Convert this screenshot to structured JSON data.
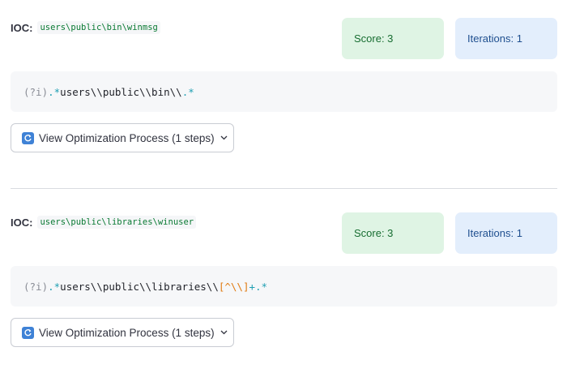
{
  "entries": [
    {
      "ioc_label": "IOC:",
      "ioc_value": "users\\public\\bin\\winmsg",
      "score_label": "Score: 3",
      "iterations_label": "Iterations: 1",
      "regex_tokens": [
        {
          "t": "(?i)",
          "k": "paren"
        },
        {
          "t": ".*",
          "k": "op"
        },
        {
          "t": "users\\\\public\\\\bin\\\\",
          "k": "text"
        },
        {
          "t": ".*",
          "k": "op"
        }
      ],
      "expander_label": "View Optimization Process (1 steps)",
      "expander_icon": "refresh-icon",
      "expander_chevron": "chevron-down-icon"
    },
    {
      "ioc_label": "IOC:",
      "ioc_value": "users\\public\\libraries\\winuser",
      "score_label": "Score: 3",
      "iterations_label": "Iterations: 1",
      "regex_tokens": [
        {
          "t": "(?i)",
          "k": "paren"
        },
        {
          "t": ".*",
          "k": "op"
        },
        {
          "t": "users\\\\public\\\\libraries\\\\",
          "k": "text"
        },
        {
          "t": "[^\\\\]",
          "k": "class"
        },
        {
          "t": "+",
          "k": "op"
        },
        {
          "t": ".*",
          "k": "op"
        }
      ],
      "expander_label": "View Optimization Process (1 steps)",
      "expander_icon": "refresh-icon",
      "expander_chevron": "chevron-down-icon"
    }
  ],
  "colors": {
    "score_bg": "#dff4e4",
    "iterations_bg": "#e3eefc",
    "ioc_value": "#0a7a33",
    "regex_operator": "#1f9fb3",
    "regex_class": "#e07b12"
  }
}
